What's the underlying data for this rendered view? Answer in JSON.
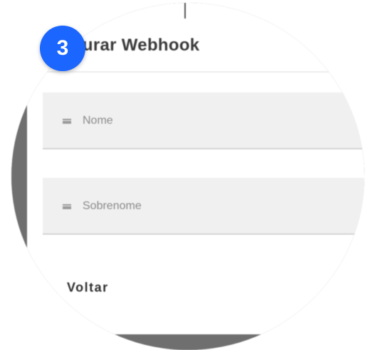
{
  "step": {
    "number": "3",
    "color": "#1a66ff"
  },
  "dialog": {
    "title": "Configurar Webhook",
    "visible_title": "igurar Webhook"
  },
  "fields": [
    {
      "icon": "text-lines-icon",
      "placeholder": "Nome",
      "value": ""
    },
    {
      "icon": "text-lines-icon",
      "placeholder": "Sobrenome",
      "value": ""
    }
  ],
  "actions": {
    "back_label": "Voltar"
  }
}
